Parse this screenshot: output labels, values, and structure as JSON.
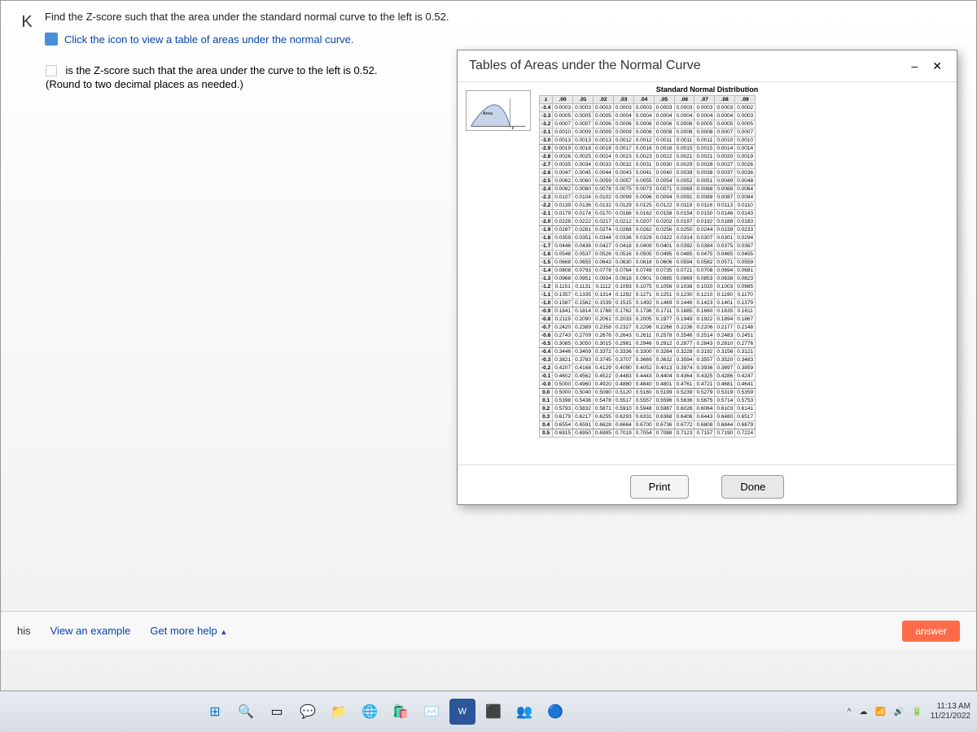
{
  "question": {
    "prompt": "Find the Z-score such that the area under the standard normal curve to the left is 0.52.",
    "link_text": "Click the icon to view a table of areas under the normal curve.",
    "answer_prefix": "is the Z-score such that the area under the curve to the left is 0.52.",
    "round_hint": "(Round to two decimal places as needed.)"
  },
  "popup": {
    "title": "Tables of Areas under the Normal Curve",
    "table_title": "Standard Normal Distribution",
    "minimize": "–",
    "close": "✕",
    "print_btn": "Print",
    "done_btn": "Done",
    "area_label": "Area",
    "z_label": "z"
  },
  "bottom": {
    "his": "his",
    "view_example": "View an example",
    "get_help": "Get more help",
    "answer": "answer"
  },
  "taskbar": {
    "time": "11:13 AM",
    "date": "11/21/2022"
  },
  "chart_data": {
    "type": "table",
    "title": "Standard Normal Distribution",
    "col_headers": [
      "z",
      ".00",
      ".01",
      ".02",
      ".03",
      ".04",
      ".05",
      ".06",
      ".07",
      ".08",
      ".09"
    ],
    "rows": [
      [
        "-3.4",
        "0.0003",
        "0.0003",
        "0.0003",
        "0.0003",
        "0.0003",
        "0.0003",
        "0.0003",
        "0.0003",
        "0.0003",
        "0.0002"
      ],
      [
        "-3.3",
        "0.0005",
        "0.0005",
        "0.0005",
        "0.0004",
        "0.0004",
        "0.0004",
        "0.0004",
        "0.0004",
        "0.0004",
        "0.0003"
      ],
      [
        "-3.2",
        "0.0007",
        "0.0007",
        "0.0006",
        "0.0006",
        "0.0006",
        "0.0006",
        "0.0006",
        "0.0005",
        "0.0005",
        "0.0005"
      ],
      [
        "-3.1",
        "0.0010",
        "0.0009",
        "0.0009",
        "0.0009",
        "0.0008",
        "0.0008",
        "0.0008",
        "0.0008",
        "0.0007",
        "0.0007"
      ],
      [
        "-3.0",
        "0.0013",
        "0.0013",
        "0.0013",
        "0.0012",
        "0.0012",
        "0.0011",
        "0.0011",
        "0.0011",
        "0.0010",
        "0.0010"
      ],
      [
        "-2.9",
        "0.0019",
        "0.0018",
        "0.0018",
        "0.0017",
        "0.0016",
        "0.0016",
        "0.0015",
        "0.0015",
        "0.0014",
        "0.0014"
      ],
      [
        "-2.8",
        "0.0026",
        "0.0025",
        "0.0024",
        "0.0023",
        "0.0023",
        "0.0022",
        "0.0021",
        "0.0021",
        "0.0020",
        "0.0019"
      ],
      [
        "-2.7",
        "0.0035",
        "0.0034",
        "0.0033",
        "0.0032",
        "0.0031",
        "0.0030",
        "0.0029",
        "0.0028",
        "0.0027",
        "0.0026"
      ],
      [
        "-2.6",
        "0.0047",
        "0.0045",
        "0.0044",
        "0.0043",
        "0.0041",
        "0.0040",
        "0.0039",
        "0.0038",
        "0.0037",
        "0.0036"
      ],
      [
        "-2.5",
        "0.0062",
        "0.0060",
        "0.0059",
        "0.0057",
        "0.0055",
        "0.0054",
        "0.0052",
        "0.0051",
        "0.0049",
        "0.0048"
      ],
      [
        "-2.4",
        "0.0082",
        "0.0080",
        "0.0078",
        "0.0075",
        "0.0073",
        "0.0071",
        "0.0069",
        "0.0068",
        "0.0066",
        "0.0064"
      ],
      [
        "-2.3",
        "0.0107",
        "0.0104",
        "0.0102",
        "0.0099",
        "0.0096",
        "0.0094",
        "0.0091",
        "0.0089",
        "0.0087",
        "0.0084"
      ],
      [
        "-2.2",
        "0.0139",
        "0.0136",
        "0.0132",
        "0.0129",
        "0.0125",
        "0.0122",
        "0.0119",
        "0.0116",
        "0.0113",
        "0.0110"
      ],
      [
        "-2.1",
        "0.0179",
        "0.0174",
        "0.0170",
        "0.0166",
        "0.0162",
        "0.0158",
        "0.0154",
        "0.0150",
        "0.0146",
        "0.0143"
      ],
      [
        "-2.0",
        "0.0228",
        "0.0222",
        "0.0217",
        "0.0212",
        "0.0207",
        "0.0202",
        "0.0197",
        "0.0192",
        "0.0188",
        "0.0183"
      ],
      [
        "-1.9",
        "0.0287",
        "0.0281",
        "0.0274",
        "0.0268",
        "0.0262",
        "0.0256",
        "0.0250",
        "0.0244",
        "0.0239",
        "0.0233"
      ],
      [
        "-1.8",
        "0.0359",
        "0.0351",
        "0.0344",
        "0.0336",
        "0.0329",
        "0.0322",
        "0.0314",
        "0.0307",
        "0.0301",
        "0.0294"
      ],
      [
        "-1.7",
        "0.0446",
        "0.0436",
        "0.0427",
        "0.0418",
        "0.0409",
        "0.0401",
        "0.0392",
        "0.0384",
        "0.0375",
        "0.0367"
      ],
      [
        "-1.6",
        "0.0548",
        "0.0537",
        "0.0526",
        "0.0516",
        "0.0505",
        "0.0495",
        "0.0485",
        "0.0475",
        "0.0465",
        "0.0455"
      ],
      [
        "-1.5",
        "0.0668",
        "0.0655",
        "0.0643",
        "0.0630",
        "0.0618",
        "0.0606",
        "0.0594",
        "0.0582",
        "0.0571",
        "0.0559"
      ],
      [
        "-1.4",
        "0.0808",
        "0.0793",
        "0.0778",
        "0.0764",
        "0.0749",
        "0.0735",
        "0.0721",
        "0.0708",
        "0.0694",
        "0.0681"
      ],
      [
        "-1.3",
        "0.0968",
        "0.0951",
        "0.0934",
        "0.0918",
        "0.0901",
        "0.0885",
        "0.0869",
        "0.0853",
        "0.0838",
        "0.0823"
      ],
      [
        "-1.2",
        "0.1151",
        "0.1131",
        "0.1112",
        "0.1093",
        "0.1075",
        "0.1056",
        "0.1038",
        "0.1020",
        "0.1003",
        "0.0985"
      ],
      [
        "-1.1",
        "0.1357",
        "0.1335",
        "0.1314",
        "0.1292",
        "0.1271",
        "0.1251",
        "0.1230",
        "0.1210",
        "0.1190",
        "0.1170"
      ],
      [
        "-1.0",
        "0.1587",
        "0.1562",
        "0.1539",
        "0.1515",
        "0.1492",
        "0.1469",
        "0.1446",
        "0.1423",
        "0.1401",
        "0.1379"
      ],
      [
        "-0.9",
        "0.1841",
        "0.1814",
        "0.1788",
        "0.1762",
        "0.1736",
        "0.1711",
        "0.1685",
        "0.1660",
        "0.1635",
        "0.1611"
      ],
      [
        "-0.8",
        "0.2119",
        "0.2090",
        "0.2061",
        "0.2033",
        "0.2005",
        "0.1977",
        "0.1949",
        "0.1922",
        "0.1894",
        "0.1867"
      ],
      [
        "-0.7",
        "0.2420",
        "0.2389",
        "0.2358",
        "0.2327",
        "0.2296",
        "0.2266",
        "0.2236",
        "0.2206",
        "0.2177",
        "0.2148"
      ],
      [
        "-0.6",
        "0.2743",
        "0.2709",
        "0.2676",
        "0.2643",
        "0.2611",
        "0.2578",
        "0.2546",
        "0.2514",
        "0.2483",
        "0.2451"
      ],
      [
        "-0.5",
        "0.3085",
        "0.3050",
        "0.3015",
        "0.2981",
        "0.2946",
        "0.2912",
        "0.2877",
        "0.2843",
        "0.2810",
        "0.2776"
      ],
      [
        "-0.4",
        "0.3446",
        "0.3409",
        "0.3372",
        "0.3336",
        "0.3300",
        "0.3264",
        "0.3228",
        "0.3192",
        "0.3156",
        "0.3121"
      ],
      [
        "-0.3",
        "0.3821",
        "0.3783",
        "0.3745",
        "0.3707",
        "0.3669",
        "0.3632",
        "0.3594",
        "0.3557",
        "0.3520",
        "0.3483"
      ],
      [
        "-0.2",
        "0.4207",
        "0.4168",
        "0.4129",
        "0.4090",
        "0.4052",
        "0.4013",
        "0.3974",
        "0.3936",
        "0.3897",
        "0.3859"
      ],
      [
        "-0.1",
        "0.4602",
        "0.4562",
        "0.4522",
        "0.4483",
        "0.4443",
        "0.4404",
        "0.4364",
        "0.4325",
        "0.4286",
        "0.4247"
      ],
      [
        "-0.0",
        "0.5000",
        "0.4960",
        "0.4920",
        "0.4880",
        "0.4840",
        "0.4801",
        "0.4761",
        "0.4721",
        "0.4681",
        "0.4641"
      ],
      [
        "0.0",
        "0.5000",
        "0.5040",
        "0.5080",
        "0.5120",
        "0.5160",
        "0.5199",
        "0.5239",
        "0.5279",
        "0.5319",
        "0.5359"
      ],
      [
        "0.1",
        "0.5398",
        "0.5438",
        "0.5478",
        "0.5517",
        "0.5557",
        "0.5596",
        "0.5636",
        "0.5675",
        "0.5714",
        "0.5753"
      ],
      [
        "0.2",
        "0.5793",
        "0.5832",
        "0.5871",
        "0.5910",
        "0.5948",
        "0.5987",
        "0.6026",
        "0.6064",
        "0.6103",
        "0.6141"
      ],
      [
        "0.3",
        "0.6179",
        "0.6217",
        "0.6255",
        "0.6293",
        "0.6331",
        "0.6368",
        "0.6406",
        "0.6443",
        "0.6480",
        "0.6517"
      ],
      [
        "0.4",
        "0.6554",
        "0.6591",
        "0.6628",
        "0.6664",
        "0.6700",
        "0.6736",
        "0.6772",
        "0.6808",
        "0.6844",
        "0.6879"
      ],
      [
        "0.5",
        "0.6915",
        "0.6950",
        "0.6985",
        "0.7019",
        "0.7054",
        "0.7088",
        "0.7123",
        "0.7157",
        "0.7190",
        "0.7224"
      ]
    ]
  }
}
